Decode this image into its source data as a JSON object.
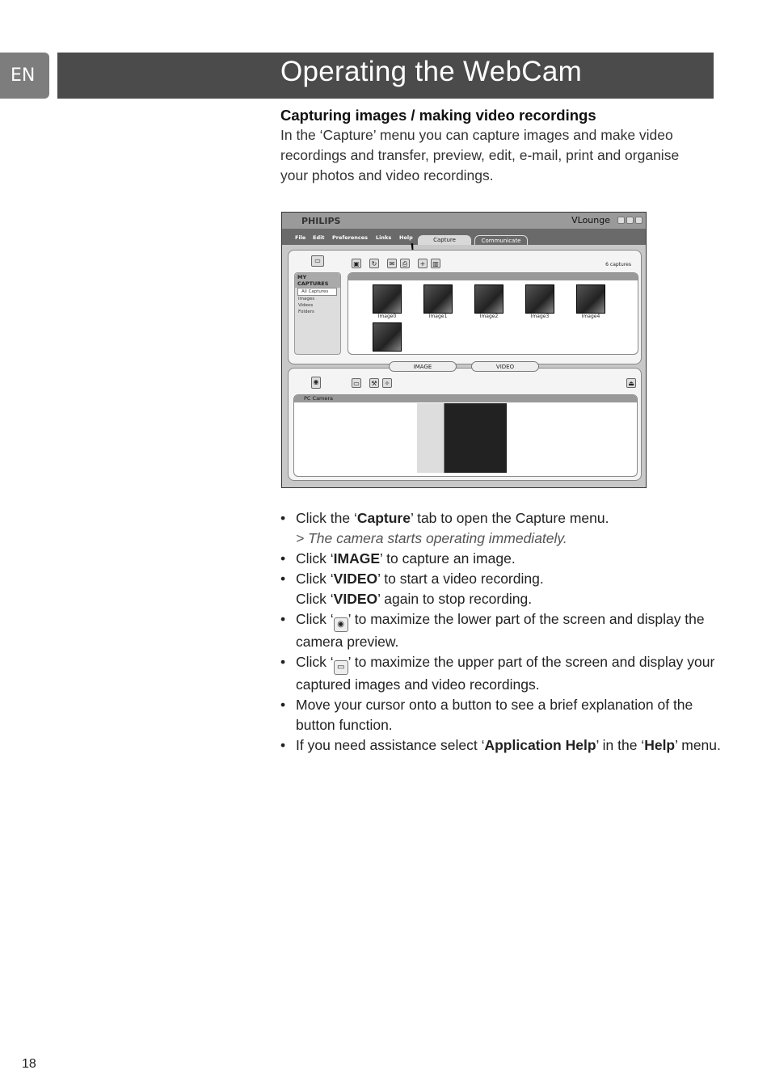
{
  "lang_tab": "EN",
  "title": "Operating the WebCam",
  "section_heading": "Capturing images / making video recordings",
  "intro": "In the ‘Capture’ menu you can capture images and make video recordings and transfer, preview, edit, e-mail, print and organise your photos and video recordings.",
  "app": {
    "brand": "PHILIPS",
    "window_title": "VLounge",
    "menu": [
      "File",
      "Edit",
      "Preferences",
      "Links",
      "Help"
    ],
    "tabs": [
      "Capture",
      "Communicate"
    ],
    "captures_count": "6 captures",
    "sidebar_header": "MY CAPTURES",
    "sidebar_items": [
      "All Captures",
      "Images",
      "Videos",
      "Folders"
    ],
    "thumbnails": [
      "Image0",
      "Image1",
      "Image2",
      "Image3",
      "Image4",
      ""
    ],
    "image_button": "IMAGE",
    "video_button": "VIDEO",
    "camera_header": "PC Camera"
  },
  "bullets": {
    "b1a": "Click the ‘",
    "b1b": "Capture",
    "b1c": "’ tab to open the Capture menu.",
    "b1note": "> The camera starts operating immediately.",
    "b2a": "Click ‘",
    "b2b": "IMAGE",
    "b2c": "’ to capture an image.",
    "b3a": "Click ‘",
    "b3b": "VIDEO",
    "b3c": "’ to start a video recording.",
    "b3d": "Click ‘",
    "b3e": "VIDEO",
    "b3f": "’ again to stop recording.",
    "b4a": "Click ‘",
    "b4c": "’ to maximize the lower part of the screen and display the camera preview.",
    "b5a": "Click ‘",
    "b5c": "’ to maximize the upper part of the screen and display your captured images and video recordings.",
    "b6": "Move your cursor onto a button to see a brief explanation of the button function.",
    "b7a": "If you need assistance select ‘",
    "b7b": "Application Help",
    "b7c": "’ in the ‘",
    "b7d": "Help",
    "b7e": "’ menu."
  },
  "page_number": "18"
}
